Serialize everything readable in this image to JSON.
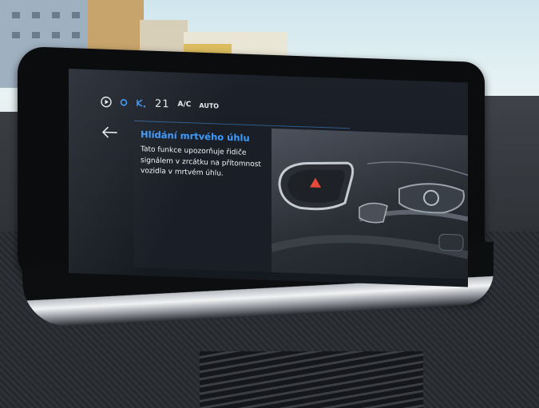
{
  "screen": {
    "status_bar": {
      "temperature": "21",
      "ac_label": "A/C",
      "auto_label": "AUTO"
    },
    "content": {
      "title": "Hlídání mrtvého úhlu",
      "description": "Tato funkce upozorňuje řidiče signálem v zrcátku na přítomnost vozidla v mrtvém úhlu."
    },
    "colors": {
      "accent": "#3d9bff",
      "warning": "#e8483a",
      "screen_bg": "#1a1f27"
    }
  }
}
